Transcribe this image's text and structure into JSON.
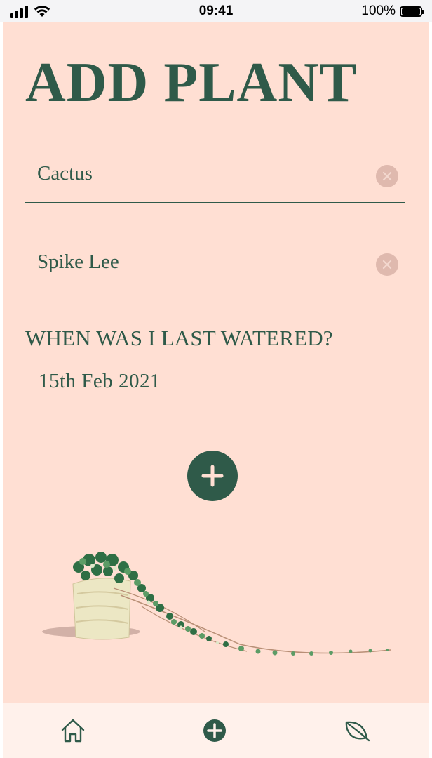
{
  "status_bar": {
    "time": "09:41",
    "battery_percent": "100%"
  },
  "page": {
    "title": "ADD PLANT"
  },
  "form": {
    "plant_name": {
      "value": "Cactus"
    },
    "plant_nickname": {
      "value": "Spike Lee"
    },
    "last_watered": {
      "label": "WHEN WAS I LAST WATERED?",
      "value": "15th Feb 2021"
    }
  },
  "tab_bar": {
    "items": [
      {
        "icon": "home-icon",
        "active": false
      },
      {
        "icon": "add-circle-icon",
        "active": true
      },
      {
        "icon": "leaf-icon",
        "active": false
      }
    ]
  },
  "colors": {
    "background": "#ffdfd3",
    "accent": "#2f5a49",
    "clear_button": "#dfb9ae",
    "tab_bar": "#fff1eb"
  }
}
